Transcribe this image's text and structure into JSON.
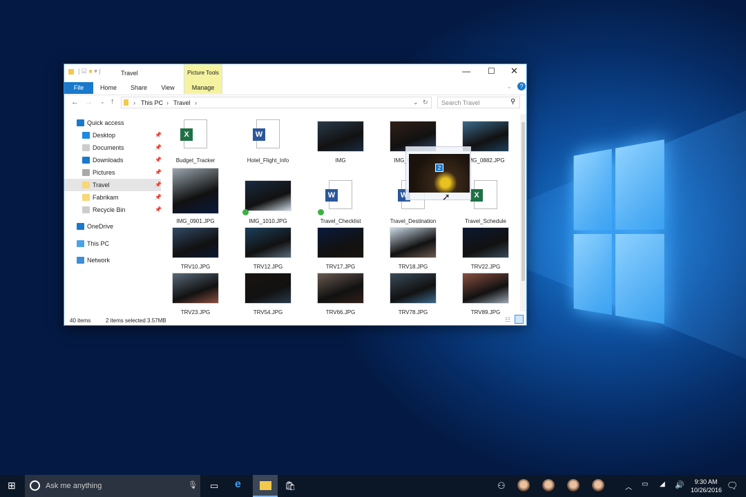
{
  "window": {
    "title": "Travel",
    "context_tab_group": "Picture Tools",
    "tabs": [
      {
        "label": "File"
      },
      {
        "label": "Home"
      },
      {
        "label": "Share"
      },
      {
        "label": "View"
      },
      {
        "label": "Manage"
      }
    ],
    "breadcrumb": [
      "This PC",
      "Travel"
    ],
    "search_placeholder": "Search Travel",
    "nav": [
      {
        "label": "Quick access",
        "icon": "star-icon"
      },
      {
        "label": "Desktop",
        "icon": "desktop-icon",
        "pinned": true
      },
      {
        "label": "Documents",
        "icon": "documents-icon",
        "pinned": true
      },
      {
        "label": "Downloads",
        "icon": "download-icon",
        "pinned": true
      },
      {
        "label": "Pictures",
        "icon": "pictures-icon",
        "pinned": true
      },
      {
        "label": "Travel",
        "icon": "folder-icon",
        "pinned": true,
        "selected": true
      },
      {
        "label": "Fabrikam",
        "icon": "folder-icon",
        "pinned": true
      },
      {
        "label": "Recycle Bin",
        "icon": "recycle-bin-icon",
        "pinned": true
      },
      {
        "label": "OneDrive",
        "icon": "cloud-icon"
      },
      {
        "label": "This PC",
        "icon": "computer-icon"
      },
      {
        "label": "Network",
        "icon": "network-icon"
      }
    ],
    "files": [
      {
        "name": "Budget_Tracker",
        "type": "excel"
      },
      {
        "name": "Hotel_Flight_Info",
        "type": "word"
      },
      {
        "name": "IMG",
        "type": "image",
        "dragging": true
      },
      {
        "name": "IMG_0639.JPG",
        "type": "image"
      },
      {
        "name": "IMG_0882.JPG",
        "type": "image"
      },
      {
        "name": "IMG_0901.JPG",
        "type": "image"
      },
      {
        "name": "IMG_1010.JPG",
        "type": "image",
        "selected": true
      },
      {
        "name": "Travel_Checklist",
        "type": "word",
        "selected": true
      },
      {
        "name": "Travel_Destination",
        "type": "word"
      },
      {
        "name": "Travel_Schedule",
        "type": "excel"
      },
      {
        "name": "TRV10.JPG",
        "type": "image"
      },
      {
        "name": "TRV12.JPG",
        "type": "image"
      },
      {
        "name": "TRV17.JPG",
        "type": "image"
      },
      {
        "name": "TRV18.JPG",
        "type": "image"
      },
      {
        "name": "TRV22.JPG",
        "type": "image"
      },
      {
        "name": "TRV23.JPG",
        "type": "image"
      },
      {
        "name": "TRV54.JPG",
        "type": "image"
      },
      {
        "name": "TRV66.JPG",
        "type": "image"
      },
      {
        "name": "TRV78.JPG",
        "type": "image"
      },
      {
        "name": "TRV89.JPG",
        "type": "image"
      }
    ],
    "drag_count": "2",
    "status": {
      "items": "40 items",
      "selection": "2 items selected 3.57MB"
    }
  },
  "taskbar": {
    "search_placeholder": "Ask me anything",
    "time": "9:30 AM",
    "date": "10/26/2016"
  },
  "colors": {
    "accent": "#1979ca",
    "context_tab": "#f5f3a0",
    "taskbar": "#0b1626"
  }
}
